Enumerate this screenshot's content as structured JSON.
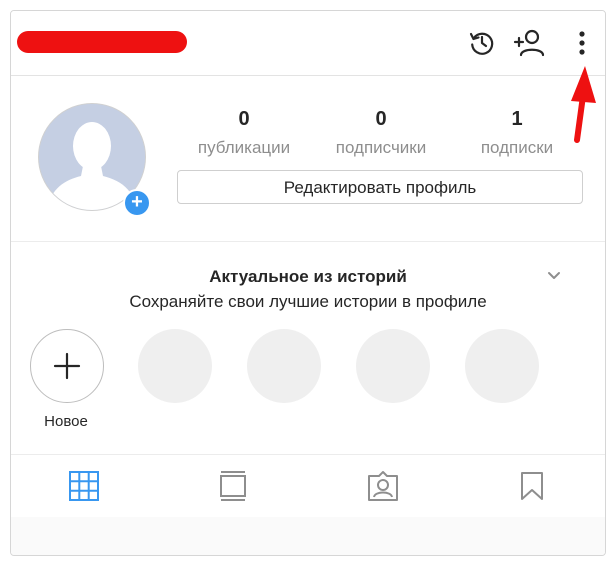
{
  "header": {
    "username_redacted": true,
    "icons": [
      "history-icon",
      "add-person-icon",
      "more-options-icon"
    ]
  },
  "profile": {
    "stats": [
      {
        "value": "0",
        "label": "публикации"
      },
      {
        "value": "0",
        "label": "подписчики"
      },
      {
        "value": "1",
        "label": "подписки"
      }
    ],
    "edit_button_label": "Редактировать профиль"
  },
  "highlights": {
    "title": "Актуальное из историй",
    "subtitle": "Сохраняйте свои лучшие истории в профиле",
    "new_label": "Новое"
  },
  "tabs": [
    "grid-icon",
    "feed-icon",
    "tagged-icon",
    "saved-icon"
  ],
  "colors": {
    "accent": "#3897f0",
    "annotation_red": "#ee1111",
    "muted_text": "#8e8e8e",
    "placeholder_circle": "#efefef"
  }
}
